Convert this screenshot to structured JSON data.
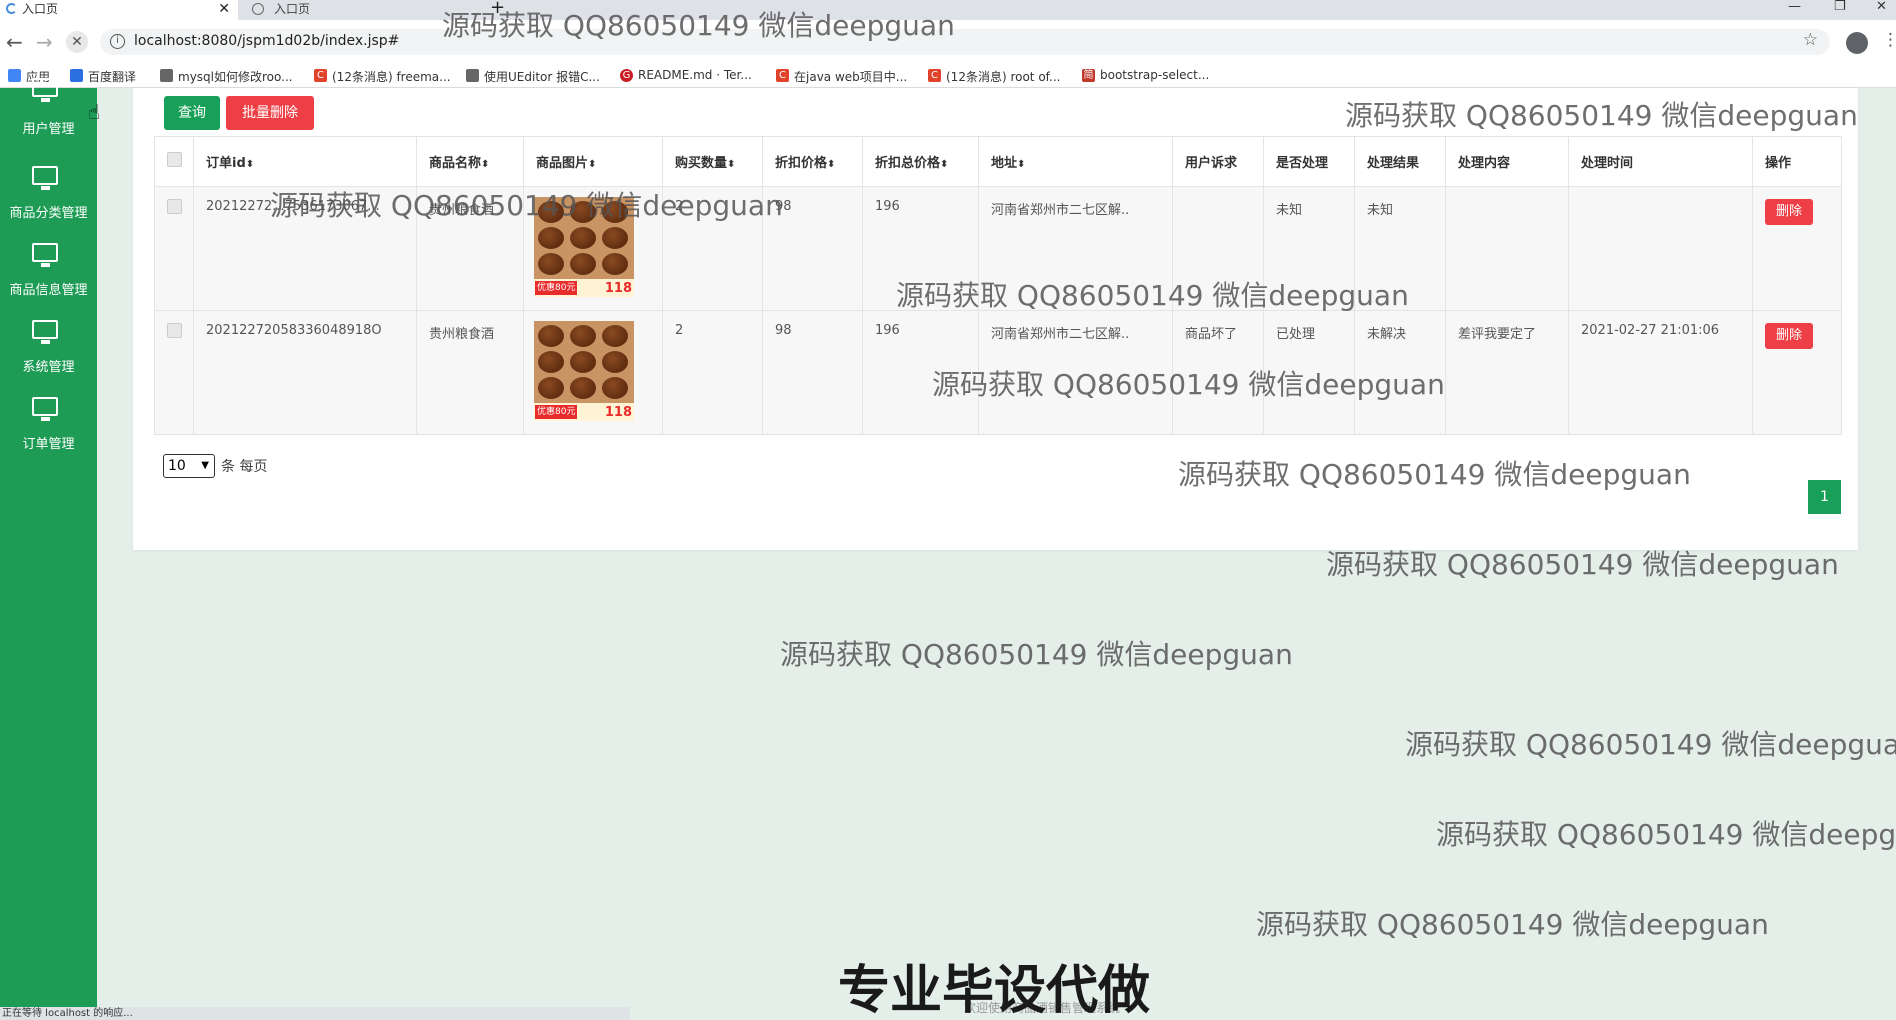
{
  "browser": {
    "tabs": [
      {
        "title": "入口页"
      },
      {
        "title": "入口页"
      }
    ],
    "tab_close": "✕",
    "new_tab": "+",
    "window_controls": {
      "minimize": "—",
      "restore": "❐",
      "close": "✕"
    },
    "nav": {
      "back": "←",
      "forward": "→",
      "stop": "✕"
    },
    "url": "localhost:8080/jspm1d02b/index.jsp#",
    "star": "☆",
    "menu": "⋮",
    "bookmarks": [
      {
        "label": "应用",
        "icon_color": "#4285f4",
        "icon": "apps-icon"
      },
      {
        "label": "百度翻译",
        "icon_color": "#2b6fe0",
        "icon": "translate-icon"
      },
      {
        "label": "mysql如何修改roo...",
        "icon_color": "#666666",
        "icon": "page-icon"
      },
      {
        "label": "(12条消息) freema...",
        "icon_color": "#e0422a",
        "icon": "csdn-icon"
      },
      {
        "label": "使用UEditor 报错C...",
        "icon_color": "#666666",
        "icon": "page-icon"
      },
      {
        "label": "README.md · Ter...",
        "icon_color": "#c71d23",
        "icon": "gitee-icon"
      },
      {
        "label": "在java web项目中...",
        "icon_color": "#e0422a",
        "icon": "csdn-icon"
      },
      {
        "label": "(12条消息) root of...",
        "icon_color": "#e0422a",
        "icon": "csdn-icon"
      },
      {
        "label": "bootstrap-select...",
        "icon_color": "#c0392b",
        "icon": "jianshu-icon"
      }
    ]
  },
  "sidebar": {
    "bg_color": "#1e9c56",
    "items": [
      {
        "label": "用户管理",
        "icon": "monitor-icon"
      },
      {
        "label": "商品分类管理",
        "icon": "monitor-icon"
      },
      {
        "label": "商品信息管理",
        "icon": "monitor-icon"
      },
      {
        "label": "系统管理",
        "icon": "monitor-icon"
      },
      {
        "label": "订单管理",
        "icon": "monitor-icon"
      }
    ]
  },
  "toolbar": {
    "query_label": "查询",
    "batch_delete_label": "批量删除",
    "query_color": "#18a058",
    "delete_color": "#ed3f45"
  },
  "table": {
    "columns": [
      "订单id",
      "商品名称",
      "商品图片",
      "购买数量",
      "折扣价格",
      "折扣总价格",
      "地址",
      "用户诉求",
      "是否处理",
      "处理结果",
      "处理内容",
      "处理时间",
      "操作"
    ],
    "sort_glyph": "⬍",
    "rows": [
      {
        "order_id": "20212272...7536173067...",
        "product_name": "贵州粮食酒",
        "image_promo": "优惠80元",
        "image_price": "118",
        "quantity": "2",
        "discount_price": "98",
        "discount_total": "196",
        "address": "河南省郑州市二七区解..",
        "user_request": "",
        "processed": "未知",
        "result": "未知",
        "content": "",
        "time": "",
        "action": "删除"
      },
      {
        "order_id": "20212272058336048918O",
        "product_name": "贵州粮食酒",
        "image_promo": "优惠80元",
        "image_price": "118",
        "quantity": "2",
        "discount_price": "98",
        "discount_total": "196",
        "address": "河南省郑州市二七区解..",
        "user_request": "商品坏了",
        "processed": "已处理",
        "result": "未解决",
        "content": "差评我要定了",
        "time": "2021-02-27 21:01:06",
        "action": "删除"
      }
    ]
  },
  "pagination": {
    "page_size": "10",
    "page_size_label": "条 每页",
    "current_page": "1"
  },
  "statusbar": "正在等待 localhost 的响应...",
  "footer": "欢迎使用商品酒销售管理系统",
  "overlay": {
    "watermark": "源码获取 QQ86050149 微信deepguan",
    "promo": "专业毕设代做"
  }
}
